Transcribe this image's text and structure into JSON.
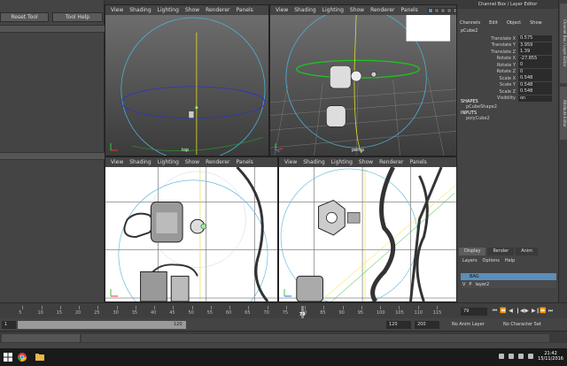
{
  "tool_panel": {
    "reset_tool": "Reset Tool",
    "tool_help": "Tool Help"
  },
  "viewport_menu": [
    "View",
    "Shading",
    "Lighting",
    "Show",
    "Renderer",
    "Panels"
  ],
  "viewports": {
    "top": {
      "label": "top"
    },
    "persp": {
      "label": "persp"
    }
  },
  "channel_box": {
    "title": "Channel Box / Layer Editor",
    "menu": [
      "Channels",
      "Edit",
      "Object",
      "Show"
    ],
    "object_name": "pCube2",
    "attributes": [
      {
        "label": "Translate X",
        "value": "0.575"
      },
      {
        "label": "Translate Y",
        "value": "3.959"
      },
      {
        "label": "Translate Z",
        "value": "1.39"
      },
      {
        "label": "Rotate X",
        "value": "-27.855"
      },
      {
        "label": "Rotate Y",
        "value": "0"
      },
      {
        "label": "Rotate Z",
        "value": "0"
      },
      {
        "label": "Scale X",
        "value": "0.548"
      },
      {
        "label": "Scale Y",
        "value": "0.548"
      },
      {
        "label": "Scale Z",
        "value": "0.548"
      },
      {
        "label": "Visibility",
        "value": "on"
      }
    ],
    "shapes_header": "SHAPES",
    "shape_name": "pCubeShape2",
    "inputs_header": "INPUTS",
    "input_name": "polyCube2"
  },
  "side_tabs": [
    "Channel Box / Layer Editor",
    "Attribute Editor"
  ],
  "layer_editor": {
    "tabs": [
      "Display",
      "Render",
      "Anim"
    ],
    "active_tab": "Display",
    "menu": [
      "Layers",
      "Options",
      "Help"
    ],
    "layers": [
      {
        "v": "",
        "p": "",
        "name": "BAG"
      },
      {
        "v": "V",
        "p": "P",
        "name": "layer2"
      }
    ]
  },
  "time_slider": {
    "ticks": [
      "5",
      "10",
      "15",
      "20",
      "25",
      "30",
      "35",
      "40",
      "45",
      "50",
      "55",
      "60",
      "65",
      "70",
      "75",
      "80",
      "85",
      "90",
      "95",
      "100",
      "105",
      "110",
      "115"
    ],
    "current_marker": "79",
    "current_time": "79",
    "playback_buttons": [
      "⏮",
      "⏪",
      "◀",
      "❙◀",
      "▶",
      "▶❙",
      "⏩",
      "⏭"
    ]
  },
  "range_slider": {
    "start": "1",
    "range_end": "120",
    "end": "120",
    "max_end": "200",
    "anim_layer": "No Anim Layer",
    "char_set": "No Character Set"
  },
  "taskbar": {
    "time": "21:42",
    "date": "15/11/2016"
  }
}
